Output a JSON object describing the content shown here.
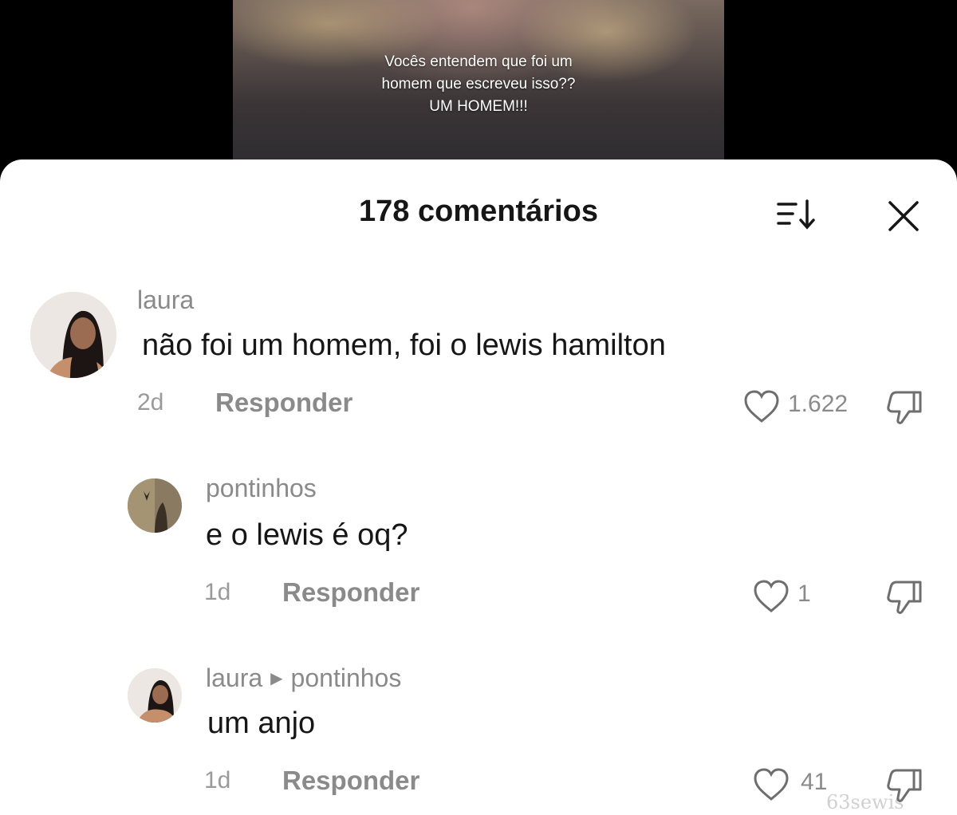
{
  "video": {
    "caption_lines": [
      "Vocês entendem que foi um",
      "homem que escreveu isso??",
      "UM HOMEM!!!"
    ]
  },
  "sheet": {
    "title": "178 comentários",
    "sort_icon": "sort-icon",
    "close_icon": "close-icon"
  },
  "comments": [
    {
      "username": "laura",
      "text": "não foi um homem, foi o lewis hamilton",
      "time": "2d",
      "reply_label": "Responder",
      "likes": "1.622"
    },
    {
      "username": "pontinhos",
      "text": "e o lewis é oq?",
      "time": "1d",
      "reply_label": "Responder",
      "likes": "1"
    },
    {
      "username": "laura",
      "reply_to": "pontinhos",
      "text": "um anjo",
      "time": "1d",
      "reply_label": "Responder",
      "likes": "41"
    }
  ],
  "watermark": "63sewis",
  "colors": {
    "text_primary": "#161616",
    "text_secondary": "#8a8a8a",
    "sheet_bg": "#ffffff",
    "backdrop": "#000000"
  }
}
